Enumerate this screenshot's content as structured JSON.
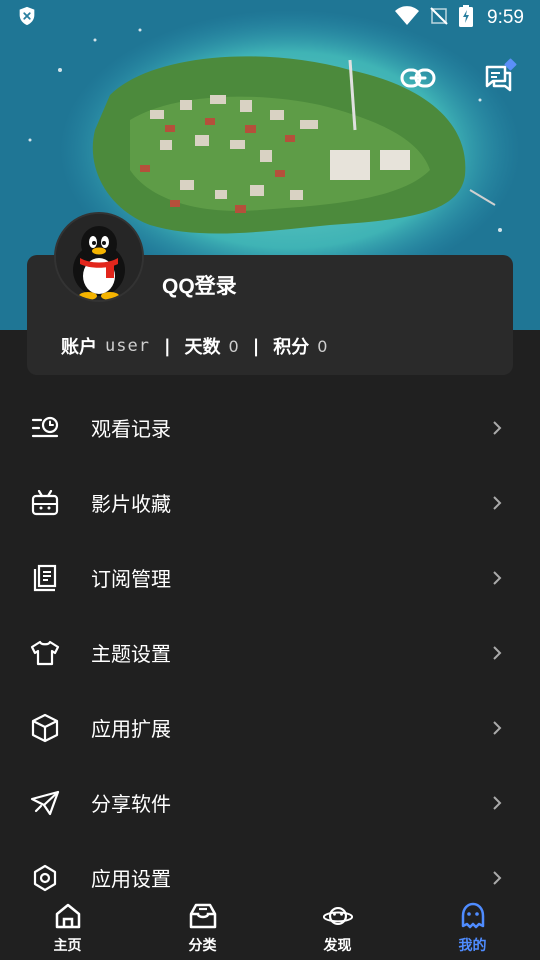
{
  "status_bar": {
    "time": "9:59",
    "icons": [
      "shield-x-icon",
      "wifi-icon",
      "signal-off-icon",
      "battery-charging-icon"
    ]
  },
  "header": {
    "link_icon": "link-icon",
    "message_icon": "message-icon",
    "accent": "#5b8ff9"
  },
  "profile": {
    "avatar_icon": "qq-penguin-icon",
    "login_label": "QQ登录",
    "stats": {
      "account_label": "账户",
      "account_value": "user",
      "days_label": "天数",
      "days_value": "0",
      "points_label": "积分",
      "points_value": "0",
      "separator": "|"
    }
  },
  "menu": {
    "items": [
      {
        "label": "观看记录",
        "icon": "history-icon"
      },
      {
        "label": "影片收藏",
        "icon": "favorites-icon"
      },
      {
        "label": "订阅管理",
        "icon": "subscription-icon"
      },
      {
        "label": "主题设置",
        "icon": "theme-shirt-icon"
      },
      {
        "label": "应用扩展",
        "icon": "extension-box-icon"
      },
      {
        "label": "分享软件",
        "icon": "share-send-icon"
      },
      {
        "label": "应用设置",
        "icon": "settings-icon"
      }
    ]
  },
  "bottom_nav": {
    "active_color": "#4f8cff",
    "items": [
      {
        "label": "主页",
        "icon": "home-icon"
      },
      {
        "label": "分类",
        "icon": "category-box-icon"
      },
      {
        "label": "发现",
        "icon": "discover-planet-icon"
      },
      {
        "label": "我的",
        "icon": "profile-face-icon"
      }
    ]
  }
}
